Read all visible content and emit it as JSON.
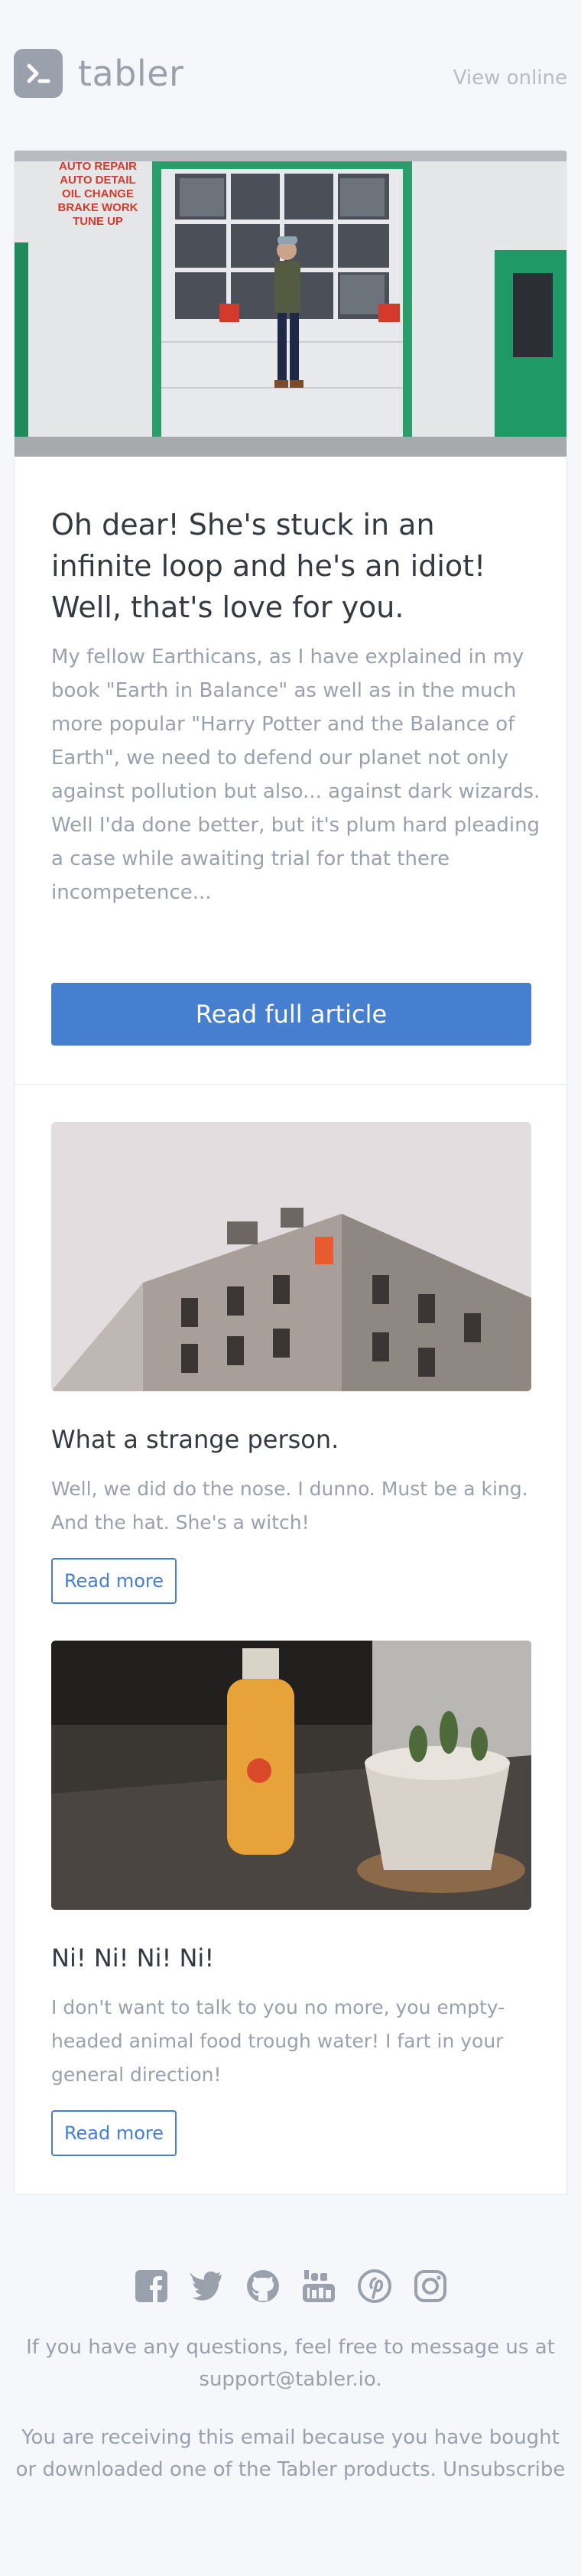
{
  "brand": {
    "name": "tabler",
    "logo_icon": "terminal-prompt-icon"
  },
  "header": {
    "view_online": "View online"
  },
  "hero": {
    "sign_lines": [
      "AUTO REPAIR",
      "AUTO DETAIL",
      "OIL CHANGE",
      "BRAKE WORK",
      "TUNE UP"
    ]
  },
  "main_article": {
    "title": "Oh dear! She's stuck in an infinite loop and he's an idiot! Well, that's love for you.",
    "text": "My fellow Earthicans, as I have explained in my book \"Earth in Balance\" as well as in the much more popular \"Harry Potter and the Balance of Earth\", we need to defend our planet not only against pollution but also... against dark wizards. Well I'da done better, but it's plum hard pleading a case while awaiting trial for that there incompetence...",
    "button": "Read full article"
  },
  "articles": [
    {
      "title": "What a strange person.",
      "text": "Well, we did do the nose. I dunno. Must be a king. And the hat. She's a witch!",
      "button": "Read more"
    },
    {
      "title": "Ni! Ni! Ni! Ni!",
      "text": "I don't want to talk to you no more, you empty-headed animal food trough water! I fart in your general direction!",
      "button": "Read more"
    }
  ],
  "footer": {
    "social_icons": [
      "facebook-icon",
      "twitter-icon",
      "github-icon",
      "youtube-icon",
      "pinterest-icon",
      "instagram-icon"
    ],
    "questions_prefix": "If you have any questions, feel free to message us at",
    "support_email": "support@tabler.io.",
    "receiving_text": "You are receiving this email because you have bought or downloaded one of the Tabler products.",
    "unsubscribe": "Unsubscribe"
  },
  "colors": {
    "accent": "#467fcf",
    "muted": "#9aa0ac",
    "background": "#f5f7fb",
    "heading": "#343a40"
  }
}
